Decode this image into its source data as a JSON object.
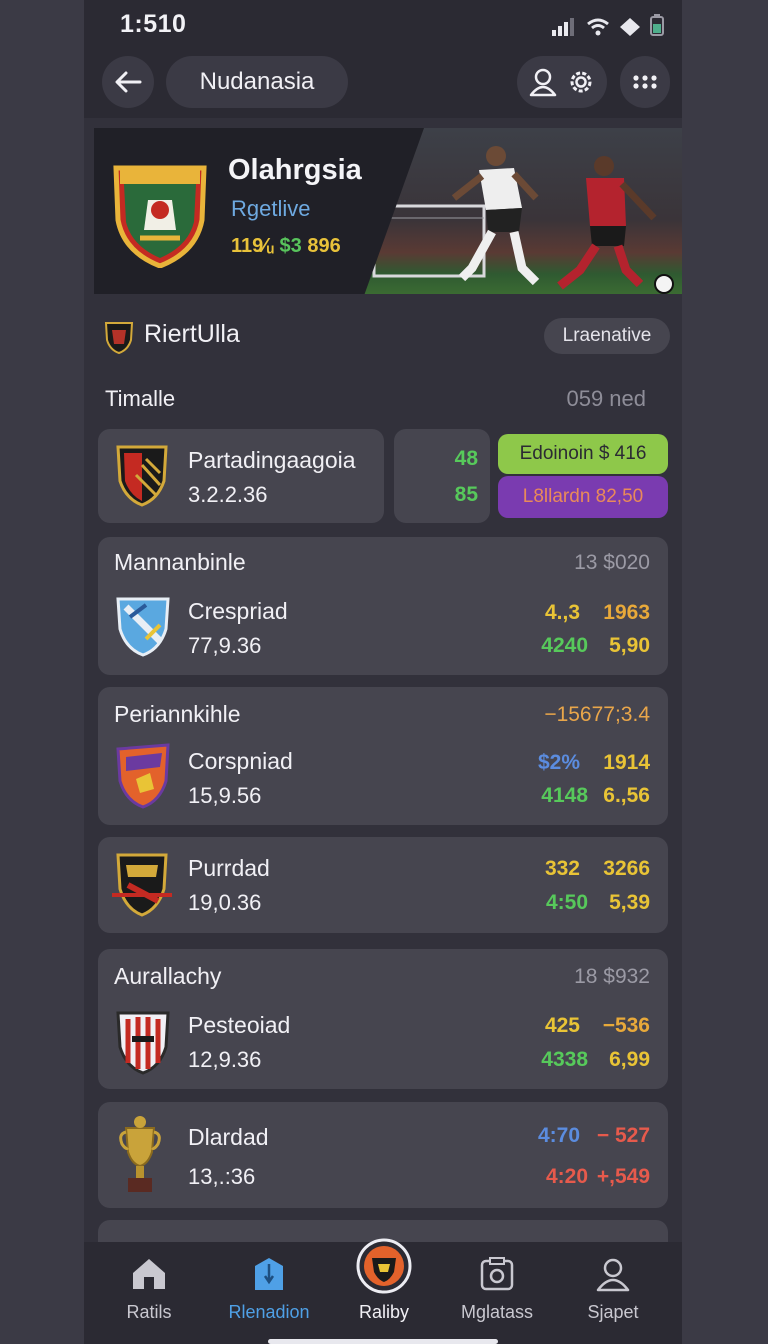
{
  "status_bar": {
    "time": "1:510"
  },
  "top_bar": {
    "title": "Nudanasia"
  },
  "hero": {
    "title": "Olahrgsia",
    "subtitle": "Rgetlive",
    "money_a": "119⁄ᵤ",
    "money_b": "$3",
    "money_c": "896"
  },
  "league": {
    "name": "RiertUlla",
    "alt_button": "Lraenative"
  },
  "section": {
    "label": "Timalle",
    "right": "059 ned"
  },
  "featured": {
    "team": "Partadingaagoia",
    "value": "3.2.2.36",
    "odd_top": "48",
    "odd_bottom": "85",
    "tag_top": "Edoinoin $ 416",
    "tag_bottom": "L8llardn 82,50"
  },
  "groups": [
    {
      "title": "Mannanbinle",
      "right": "13 $020",
      "team": "Crespriad",
      "value": "77,9.36",
      "o1": "4.,3",
      "o2": "1963",
      "o3": "4240",
      "o4": "5,90"
    },
    {
      "title": "Periannkihle",
      "right": "−15677;3.4",
      "team": "Corspniad",
      "value": "15,9.56",
      "o1": "$2%",
      "o2": "1914",
      "o3": "4148",
      "o4": "6.,56"
    },
    {
      "title": "",
      "right": "",
      "team": "Purrdad",
      "value": "19,0.36",
      "o1": "332",
      "o2": "3266",
      "o3": "4:50",
      "o4": "5,39"
    },
    {
      "title": "Aurallachy",
      "right": "18 $932",
      "team": "Pesteoiad",
      "value": "12,9.36",
      "o1": "425",
      "o2": "−536",
      "o3": "4338",
      "o4": "6,99"
    },
    {
      "title": "",
      "right": "",
      "team": "Dlardad",
      "value": "13,.:36",
      "o1": "4:70",
      "o2": "− 527",
      "o3": "4:20",
      "o4": "+,549"
    }
  ],
  "nav": [
    {
      "label": "Ratils"
    },
    {
      "label": "Rlenadion"
    },
    {
      "label": "Raliby"
    },
    {
      "label": "Mglatass"
    },
    {
      "label": "Sjapet"
    }
  ],
  "colors": {
    "accent": "#4fa0e6",
    "green": "#57c95b",
    "yellow": "#e9c436",
    "red": "#e65a4c",
    "purple": "#7a3bb0",
    "lime": "#8ec84a"
  }
}
